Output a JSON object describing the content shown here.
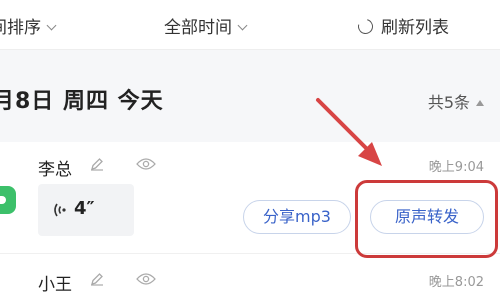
{
  "filters": {
    "sort_label": "间排序",
    "time_label": "全部时间",
    "refresh_label": "刷新列表"
  },
  "date_header": {
    "date_text": "月8日 周四 今天",
    "count_text": "共5条"
  },
  "records": [
    {
      "name": "李总",
      "time": "晚上9:04",
      "voice_duration": "4″",
      "share_mp3_label": "分享mp3",
      "forward_label": "原声转发"
    },
    {
      "name": "小王",
      "time": "晚上8:02"
    }
  ],
  "annotation": {
    "arrow_color": "#d84545",
    "box_color": "#cc3a3a"
  },
  "colors": {
    "accent_blue": "#3a63c9",
    "avatar_green": "#3cc06a"
  }
}
